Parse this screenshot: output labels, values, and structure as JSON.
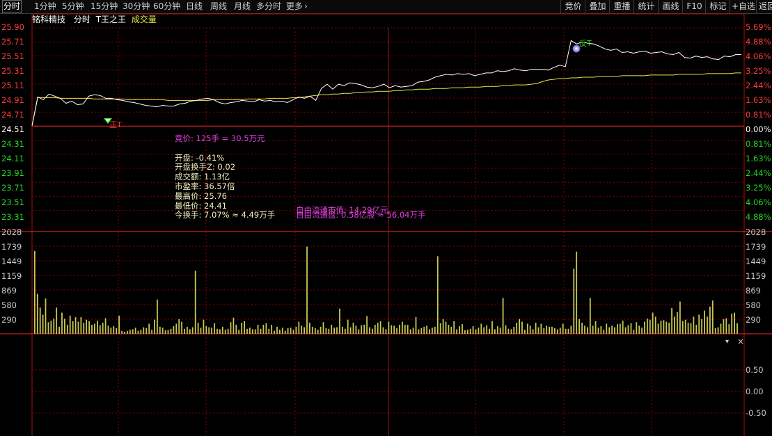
{
  "toolbar": {
    "tabs": [
      "分时",
      "1分钟",
      "5分钟",
      "15分钟",
      "30分钟",
      "60分钟",
      "日线",
      "周线",
      "月线",
      "多分时",
      "更多"
    ],
    "active_tab": "分时",
    "more_arrow": "›",
    "right_buttons": [
      "竞价",
      "叠加",
      "重播",
      "统计",
      "画线",
      "F10",
      "标记",
      "+自选",
      "返回"
    ]
  },
  "info": {
    "stock_name": "铭科精技",
    "mode": "分时",
    "indicator": "T王之王",
    "volume_label": "成交量"
  },
  "price_axis": {
    "left": [
      "25.90",
      "25.71",
      "25.51",
      "25.31",
      "25.11",
      "24.91",
      "24.71",
      "24.51",
      "24.31",
      "24.11",
      "23.91",
      "23.71",
      "23.51",
      "23.31"
    ],
    "right": [
      "5.69%",
      "4.88%",
      "4.06%",
      "3.25%",
      "2.44%",
      "1.63%",
      "0.81%",
      "0.00%",
      "0.81%",
      "1.63%",
      "2.44%",
      "3.25%",
      "4.06%",
      "4.88%"
    ]
  },
  "volume_axis": [
    "2028",
    "1739",
    "1449",
    "1159",
    "869",
    "580",
    "290"
  ],
  "indicator_axis": [
    "0.50",
    "0.00",
    "-0.50"
  ],
  "stats": {
    "auction": "竞价: 125手 = 30.5万元",
    "open": "开盘: -0.41%",
    "open_turnover": "开盘换手Z: 0.02",
    "amount": "成交额: 1.13亿",
    "pe": "市盈率: 36.57倍",
    "high": "最高价: 25.76",
    "low": "最低价: 24.41",
    "turnover": "今换手: 7.07% ≈ 4.49万手",
    "float_value": "自由流通市值: 14.29亿元",
    "float_shares": "自由流通盘: 0.58亿股 ≈ 56.04万手"
  },
  "markers": {
    "buy": "正T",
    "sell": "反T"
  },
  "panel_controls": {
    "dropdown": "▾",
    "close": "×"
  },
  "colors": {
    "up": "#ff3a3a",
    "down": "#23d823",
    "price_line": "#ffffff",
    "avg_line": "#e8e84a",
    "volume_bar": "#c8c850",
    "grid": "#8a0000",
    "stats_highlight": "#e040e0"
  },
  "chart_data": {
    "type": "line",
    "price_range": [
      23.31,
      25.9
    ],
    "prev_close": 24.51,
    "series": [
      {
        "values": [
          24.51,
          24.92,
          24.88,
          24.96,
          24.93,
          24.9,
          24.83,
          24.86,
          24.81,
          24.82,
          24.93,
          24.95,
          24.94,
          24.9,
          24.9,
          24.88,
          24.87,
          24.85,
          24.84,
          24.82,
          24.8,
          24.79,
          24.78,
          24.8,
          24.79,
          24.79,
          24.82,
          24.83,
          24.86,
          24.87,
          24.89,
          24.9,
          24.88,
          24.84,
          24.82,
          24.84,
          24.85,
          24.87,
          24.86,
          24.85,
          24.88,
          24.86,
          24.87,
          24.85,
          24.86,
          24.84,
          24.88,
          24.92,
          24.9,
          24.93,
          24.87,
          25.04,
          25.1,
          25.03,
          25.1,
          25.08,
          25.12,
          25.11,
          25.09,
          25.06,
          25.05,
          25.07,
          25.1,
          25.05,
          25.08,
          25.06,
          25.07,
          25.08,
          25.13,
          25.14,
          25.16,
          25.2,
          25.22,
          25.24,
          25.23,
          25.25,
          25.24,
          25.25,
          25.22,
          25.24,
          25.26,
          25.26,
          25.29,
          25.28,
          25.29,
          25.32,
          25.3,
          25.29,
          25.31,
          25.31,
          25.31,
          25.3,
          25.34,
          25.37,
          25.35,
          25.72,
          25.67,
          25.7,
          25.68,
          25.67,
          25.64,
          25.6,
          25.58,
          25.6,
          25.55,
          25.56,
          25.54,
          25.56,
          25.57,
          25.54,
          25.55,
          25.56,
          25.53,
          25.52,
          25.55,
          25.48,
          25.47,
          25.5,
          25.48,
          25.49,
          25.46,
          25.45,
          25.5,
          25.49,
          25.52,
          25.52
        ]
      },
      {
        "values": [
          24.51,
          24.91,
          24.91,
          24.91,
          24.91,
          24.9,
          24.9,
          24.9,
          24.9,
          24.9,
          24.9,
          24.89,
          24.89,
          24.89,
          24.89,
          24.89,
          24.89,
          24.88,
          24.88,
          24.88,
          24.88,
          24.88,
          24.88,
          24.88,
          24.87,
          24.87,
          24.87,
          24.87,
          24.87,
          24.87,
          24.87,
          24.87,
          24.88,
          24.88,
          24.88,
          24.88,
          24.88,
          24.88,
          24.89,
          24.89,
          24.89,
          24.89,
          24.9,
          24.9,
          24.9,
          24.9,
          24.91,
          24.91,
          24.92,
          24.93,
          24.94,
          24.95,
          24.95,
          24.96,
          24.96,
          24.97,
          24.97,
          24.98,
          24.98,
          24.99,
          24.99,
          25.0,
          25.0,
          25.0,
          25.01,
          25.01,
          25.02,
          25.02,
          25.03,
          25.03,
          25.03,
          25.04,
          25.04,
          25.04,
          25.05,
          25.05,
          25.05,
          25.06,
          25.06,
          25.06,
          25.07,
          25.07,
          25.07,
          25.08,
          25.08,
          25.09,
          25.09,
          25.09,
          25.1,
          25.11,
          25.14,
          25.16,
          25.17,
          25.18,
          25.18,
          25.19,
          25.19,
          25.2,
          25.2,
          25.2,
          25.21,
          25.21,
          25.21,
          25.21,
          25.22,
          25.22,
          25.22,
          25.22,
          25.22,
          25.23,
          25.23,
          25.23,
          25.23,
          25.23,
          25.24,
          25.24,
          25.24,
          25.24,
          25.24,
          25.25,
          25.25,
          25.25,
          25.25,
          25.25,
          25.26,
          25.26
        ]
      }
    ],
    "volume": {
      "range": [
        0,
        2028
      ],
      "values": [
        1640,
        790,
        520,
        380,
        700,
        230,
        260,
        300,
        520,
        140,
        420,
        300,
        180,
        360,
        250,
        330,
        240,
        330,
        220,
        280,
        250,
        180,
        200,
        260,
        170,
        220,
        310,
        160,
        120,
        150,
        110,
        360,
        60,
        40,
        60,
        80,
        90,
        120,
        60,
        80,
        130,
        110,
        200,
        80,
        280,
        680,
        140,
        120,
        70,
        80,
        100,
        150,
        200,
        290,
        240,
        100,
        140,
        90,
        130,
        1250,
        220,
        120,
        280,
        150,
        130,
        120,
        210,
        100,
        90,
        140,
        80,
        100,
        230,
        320,
        180,
        80,
        220,
        250,
        100,
        120,
        90,
        90,
        180,
        100,
        180,
        210,
        100,
        180,
        60,
        140,
        80,
        120,
        60,
        110,
        120,
        80,
        140,
        240,
        160,
        130,
        1730,
        220,
        140,
        110,
        80,
        140,
        230,
        110,
        100,
        180,
        120,
        130,
        500,
        140,
        100,
        280,
        130,
        220,
        160,
        90,
        170,
        180,
        350,
        130,
        100,
        180,
        220,
        250,
        130,
        90,
        240,
        170,
        160,
        110,
        180,
        240,
        180,
        180,
        90,
        120,
        330,
        90,
        110,
        140,
        160,
        90,
        120,
        140,
        1540,
        210,
        290,
        240,
        180,
        140,
        250,
        90,
        150,
        190,
        70,
        80,
        100,
        150,
        90,
        120,
        200,
        130,
        170,
        100,
        250,
        90,
        150,
        120,
        710,
        170,
        100,
        90,
        140,
        220,
        290,
        240,
        80,
        200,
        160,
        90,
        220,
        130,
        200,
        110,
        160,
        140,
        140,
        110,
        90,
        120,
        200,
        100,
        100,
        160,
        1290,
        1630,
        290,
        220,
        160,
        130,
        710,
        160,
        250,
        120,
        150,
        80,
        200,
        130,
        160,
        130,
        190,
        200,
        260,
        130,
        170,
        210,
        80,
        230,
        160,
        120,
        240,
        300,
        280,
        420,
        340,
        200,
        260,
        270,
        240,
        220,
        510,
        340,
        430,
        640,
        250,
        280,
        220,
        210,
        340,
        180,
        380,
        290,
        460,
        340,
        540,
        660,
        110,
        130,
        200,
        290,
        310,
        190,
        400,
        420,
        210
      ]
    }
  }
}
